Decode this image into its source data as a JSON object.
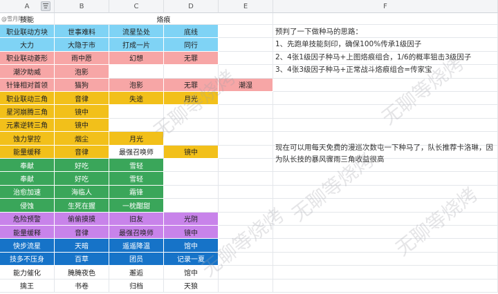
{
  "column_headers": [
    "A",
    "B",
    "C",
    "D",
    "E",
    "F"
  ],
  "header_row": {
    "a": "技能",
    "merged": "烙痕"
  },
  "author_tag": "@雪月阳阳",
  "colors": {
    "sky": "#7fd3f5",
    "pink": "#f7a6a6",
    "amber": "#f2c01a",
    "green": "#3aa65a",
    "violet": "#c883ea",
    "blue": "#1673c8",
    "white": "#ffffff"
  },
  "rows": [
    {
      "cells": [
        "职业联动方块",
        "世事难料",
        "流星坠处",
        "底线",
        ""
      ],
      "colors": [
        "sky",
        "sky",
        "sky",
        "sky",
        "white"
      ]
    },
    {
      "cells": [
        "大力",
        "大隐于市",
        "打成一片",
        "同行",
        ""
      ],
      "colors": [
        "sky",
        "sky",
        "sky",
        "sky",
        "white"
      ]
    },
    {
      "cells": [
        "职业联动菱形",
        "雨中愿",
        "幻想",
        "无罪",
        ""
      ],
      "colors": [
        "pink",
        "pink",
        "pink",
        "pink",
        "white"
      ]
    },
    {
      "cells": [
        "潮汐助威",
        "泡影",
        "",
        "",
        ""
      ],
      "colors": [
        "pink",
        "pink",
        "white",
        "white",
        "white"
      ]
    },
    {
      "cells": [
        "针锋相对首领",
        "猫狗",
        "泡影",
        "无罪",
        "潮湿"
      ],
      "colors": [
        "pink",
        "pink",
        "pink",
        "pink",
        "pink"
      ]
    },
    {
      "cells": [
        "职业联动三角",
        "音律",
        "失途",
        "月光",
        ""
      ],
      "colors": [
        "amber",
        "amber",
        "amber",
        "amber",
        "white"
      ]
    },
    {
      "cells": [
        "星河崩腾三角",
        "镜中",
        "",
        "",
        ""
      ],
      "colors": [
        "amber",
        "amber",
        "white",
        "white",
        "white"
      ]
    },
    {
      "cells": [
        "元素逆转三角",
        "镜中",
        "",
        "",
        ""
      ],
      "colors": [
        "amber",
        "amber",
        "white",
        "white",
        "white"
      ]
    },
    {
      "cells": [
        "蚀力掌控",
        "烟尘",
        "月光",
        "",
        ""
      ],
      "colors": [
        "amber",
        "amber",
        "amber",
        "white",
        "white"
      ]
    },
    {
      "cells": [
        "能量缓释",
        "音律",
        "最强召唤师",
        "镜中",
        ""
      ],
      "colors": [
        "amber",
        "amber",
        "white",
        "amber",
        "white"
      ]
    },
    {
      "cells": [
        "奉献",
        "好吃",
        "雪轻",
        "",
        ""
      ],
      "colors": [
        "green",
        "green",
        "green",
        "white",
        "white"
      ]
    },
    {
      "cells": [
        "奉献",
        "好吃",
        "雪轻",
        "",
        ""
      ],
      "colors": [
        "green",
        "green",
        "green",
        "white",
        "white"
      ]
    },
    {
      "cells": [
        "治愈加速",
        "海临人",
        "霜锋",
        "",
        ""
      ],
      "colors": [
        "green",
        "green",
        "green",
        "white",
        "white"
      ]
    },
    {
      "cells": [
        "侵蚀",
        "生死在握",
        "一枕酣甜",
        "",
        ""
      ],
      "colors": [
        "green",
        "green",
        "green",
        "white",
        "white"
      ]
    },
    {
      "cells": [
        "危险预警",
        "偷偷摸摸",
        "旧友",
        "光阴",
        ""
      ],
      "colors": [
        "violet",
        "violet",
        "violet",
        "violet",
        "white"
      ]
    },
    {
      "cells": [
        "能量缓释",
        "音律",
        "最强召唤师",
        "镜中",
        ""
      ],
      "colors": [
        "violet",
        "violet",
        "violet",
        "violet",
        "white"
      ]
    },
    {
      "cells": [
        "快步流星",
        "天暗",
        "遥遥降温",
        "馆中",
        ""
      ],
      "colors": [
        "blue",
        "blue",
        "blue",
        "blue",
        "white"
      ]
    },
    {
      "cells": [
        "技多不压身",
        "百草",
        "团员",
        "记录一夏",
        ""
      ],
      "colors": [
        "blue",
        "blue",
        "blue",
        "blue",
        "white"
      ]
    },
    {
      "cells": [
        "能力催化",
        "腌腌夜色",
        "邂逅",
        "馆中",
        ""
      ],
      "colors": [
        "white",
        "white",
        "white",
        "white",
        "white"
      ]
    },
    {
      "cells": [
        "擒王",
        "书卷",
        "归档",
        "天狼",
        ""
      ],
      "colors": [
        "white",
        "white",
        "white",
        "white",
        "white"
      ]
    }
  ],
  "notes": {
    "title": "预判了一下做种马的思路：",
    "line1": "1、先跑单技能刻印，确保100%传承1级因子",
    "line2": "2、4张1级因子种马+上图烙痕组合，1/6的概率狙击3级因子",
    "line3": "3、4张3级因子种马+正常战斗烙痕组合=传家宝",
    "paragraph": "现在可以用每天免费的漫巡次数屯一下种马了，队长推荐卡洛琳，因为队长技的暴风骤雨三角收益很高"
  },
  "watermark_text": "无聊等烧烤"
}
